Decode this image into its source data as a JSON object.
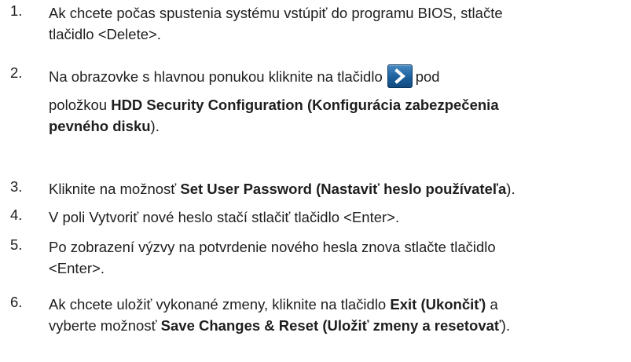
{
  "steps": [
    {
      "number": "1.",
      "lines": [
        [
          {
            "t": "Ak chcete počas spustenia systému vstúpiť do programu BIOS, stlačte",
            "b": false
          }
        ],
        [
          {
            "t": "tlačidlo <Delete>.",
            "b": false
          }
        ]
      ]
    },
    {
      "number": "2.",
      "lines": [
        [
          {
            "t": "Na obrazovke s hlavnou ponukou kliknite na tlačidlo",
            "b": false
          },
          {
            "icon": "arrow-right-button-icon"
          },
          {
            "t": "pod",
            "b": false
          }
        ],
        [
          {
            "t": "položkou ",
            "b": false
          },
          {
            "t": "HDD Security Configuration (Konfigurácia zabezpečenia",
            "b": true
          }
        ],
        [
          {
            "t": "pevného disku",
            "b": true
          },
          {
            "t": ").",
            "b": false
          }
        ]
      ]
    },
    {
      "number": "3.",
      "lines": [
        [
          {
            "t": "Kliknite na možnosť ",
            "b": false
          },
          {
            "t": "Set User Password (Nastaviť heslo používateľa",
            "b": true
          },
          {
            "t": ").",
            "b": false
          }
        ]
      ]
    },
    {
      "number": "4.",
      "lines": [
        [
          {
            "t": "V poli Vytvoriť nové heslo stačí stlačiť tlačidlo <Enter>.",
            "b": false
          }
        ]
      ]
    },
    {
      "number": "5.",
      "lines": [
        [
          {
            "t": "Po zobrazení výzvy na potvrdenie nového hesla znova stlačte tlačidlo",
            "b": false
          }
        ],
        [
          {
            "t": "<Enter>.",
            "b": false
          }
        ]
      ]
    },
    {
      "number": "6.",
      "lines": [
        [
          {
            "t": "Ak chcete uložiť vykonané zmeny, kliknite na tlačidlo ",
            "b": false
          },
          {
            "t": "Exit (Ukončiť)",
            "b": true
          },
          {
            "t": " a",
            "b": false
          }
        ],
        [
          {
            "t": "vyberte možnosť ",
            "b": false
          },
          {
            "t": "Save Changes & Reset (Uložiť zmeny a resetovať",
            "b": true
          },
          {
            "t": ").",
            "b": false
          }
        ]
      ]
    }
  ]
}
